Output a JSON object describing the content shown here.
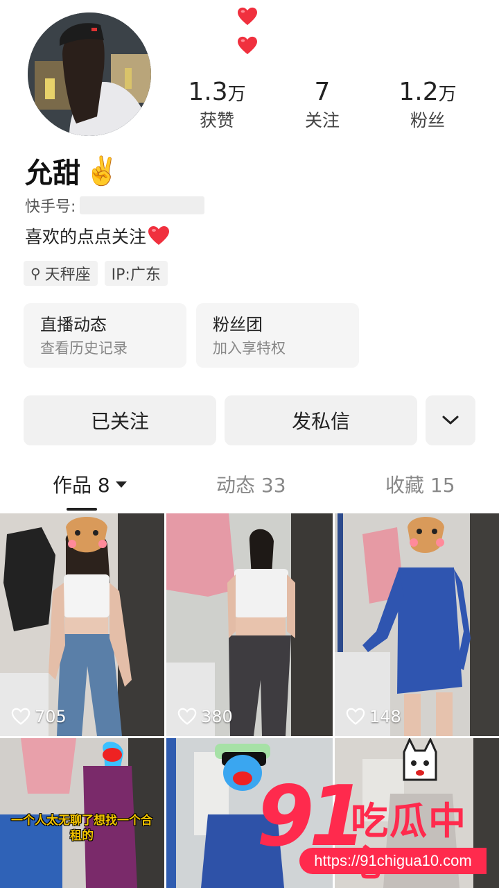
{
  "profile": {
    "name": "允甜",
    "name_emoji": "✌️",
    "kuaishou_id_label": "快手号:",
    "bio": "喜欢的点点关注",
    "tags": [
      {
        "icon": "libra-icon",
        "label": "天秤座"
      },
      {
        "label": "IP:广东"
      }
    ]
  },
  "stats": [
    {
      "value": "1.3",
      "unit": "万",
      "label": "获赞"
    },
    {
      "value": "7",
      "unit": "",
      "label": "关注"
    },
    {
      "value": "1.2",
      "unit": "万",
      "label": "粉丝"
    }
  ],
  "cards": [
    {
      "title": "直播动态",
      "subtitle": "查看历史记录"
    },
    {
      "title": "粉丝团",
      "subtitle": "加入享特权"
    }
  ],
  "actions": {
    "follow_label": "已关注",
    "message_label": "发私信",
    "more_icon": "chevron-down-icon"
  },
  "tabs": [
    {
      "label": "作品 8",
      "active": true
    },
    {
      "label": "动态 33",
      "active": false
    },
    {
      "label": "收藏 15",
      "active": false
    }
  ],
  "videos": [
    {
      "likes": "705"
    },
    {
      "likes": "380"
    },
    {
      "likes": "148"
    },
    {
      "caption": "一个人太无聊了想找一个合租的"
    },
    {},
    {}
  ],
  "watermark": {
    "number": "91",
    "text": "吃瓜中心",
    "url": "https://91chigua10.com"
  },
  "colors": {
    "heart": "#f0303e",
    "watermark": "#ff2a4d"
  }
}
